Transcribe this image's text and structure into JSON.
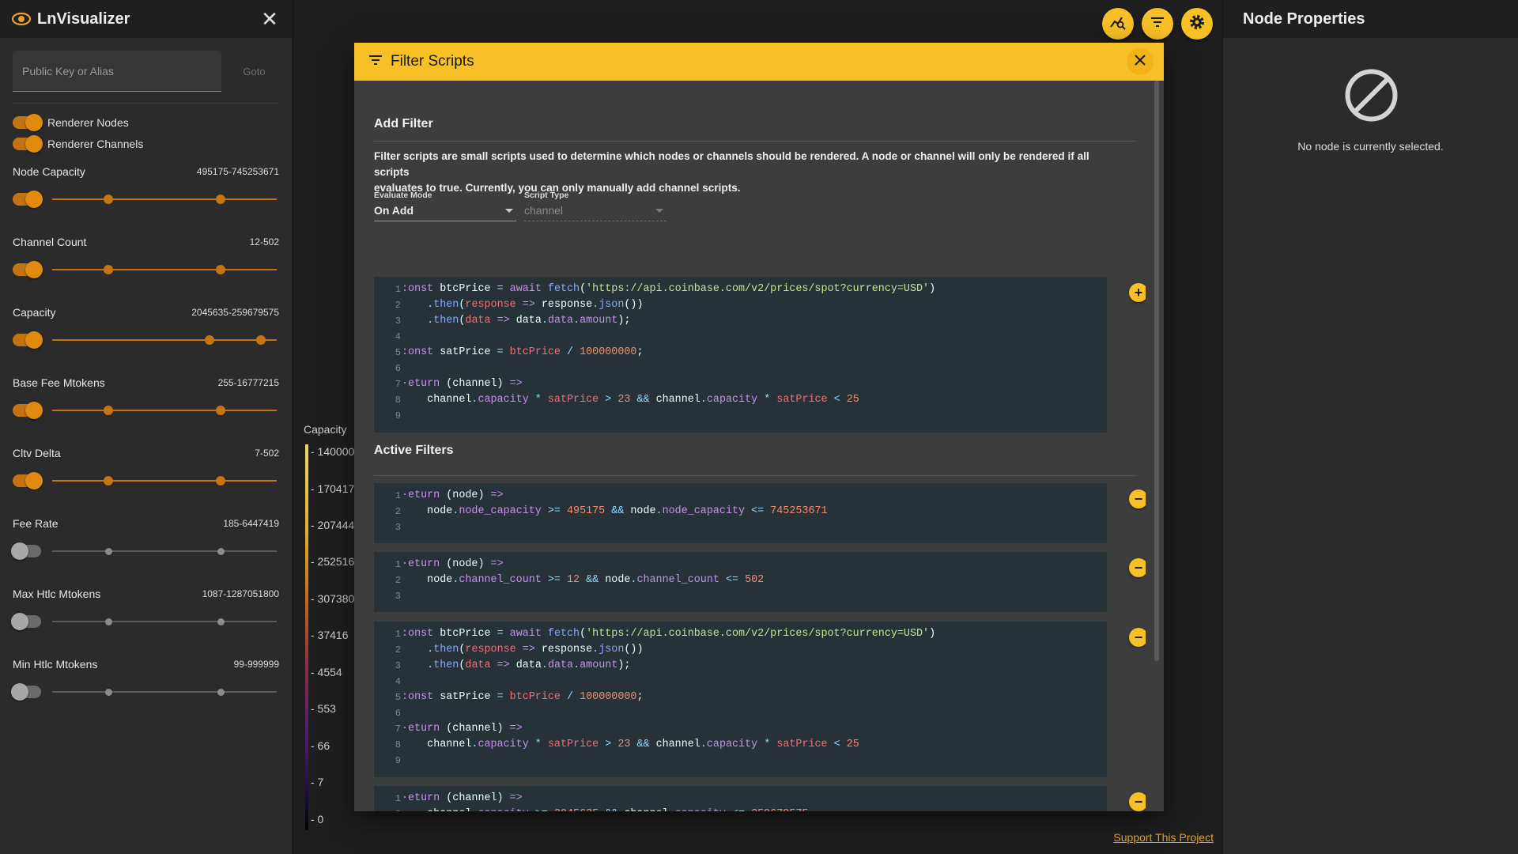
{
  "app": {
    "title": "LnVisualizer",
    "search_placeholder": "Public Key or Alias",
    "goto_label": "Goto",
    "render_nodes_label": "Renderer Nodes",
    "render_channels_label": "Renderer Channels",
    "support_link": "Support This Project"
  },
  "filters": [
    {
      "name": "Node Capacity",
      "range": "495175-745253671",
      "enabled": true,
      "low": 0.25,
      "high": 0.75
    },
    {
      "name": "Channel Count",
      "range": "12-502",
      "enabled": true,
      "low": 0.25,
      "high": 0.75
    },
    {
      "name": "Capacity",
      "range": "2045635-259679575",
      "enabled": true,
      "low": 0.7,
      "high": 0.93
    },
    {
      "name": "Base Fee Mtokens",
      "range": "255-16777215",
      "enabled": true,
      "low": 0.25,
      "high": 0.75
    },
    {
      "name": "Cltv Delta",
      "range": "7-502",
      "enabled": true,
      "low": 0.25,
      "high": 0.75
    },
    {
      "name": "Fee Rate",
      "range": "185-6447419",
      "enabled": false,
      "low": 0.25,
      "high": 0.75
    },
    {
      "name": "Max Htlc Mtokens",
      "range": "1087-1287051800",
      "enabled": false,
      "low": 0.25,
      "high": 0.75
    },
    {
      "name": "Min Htlc Mtokens",
      "range": "99-999999",
      "enabled": false,
      "low": 0.25,
      "high": 0.75
    }
  ],
  "legend": {
    "title": "Capacity",
    "ticks": [
      "- 140000",
      "- 170417",
      "- 207444",
      "- 252516",
      "- 307380",
      "- 37416",
      "- 4554",
      "- 553",
      "- 66",
      "- 7",
      "- 0"
    ]
  },
  "node_panel": {
    "title": "Node Properties",
    "empty_text": "No node is currently selected."
  },
  "dialog": {
    "title": "Filter Scripts",
    "add_filter_title": "Add Filter",
    "description_line1": "Filter scripts are small scripts used to determine which nodes or channels should be rendered. A node or channel will only be rendered if all scripts",
    "description_line2": "evaluates to true. Currently, you can only manually add channel scripts.",
    "evaluate_mode_label": "Evaluate Mode",
    "evaluate_mode_value": "On Add",
    "script_type_label": "Script Type",
    "script_type_value": "channel",
    "active_filters_title": "Active Filters"
  },
  "colors": {
    "accent": "#f6c026",
    "slider_orange": "#c47312",
    "code_bg": "#263238"
  }
}
